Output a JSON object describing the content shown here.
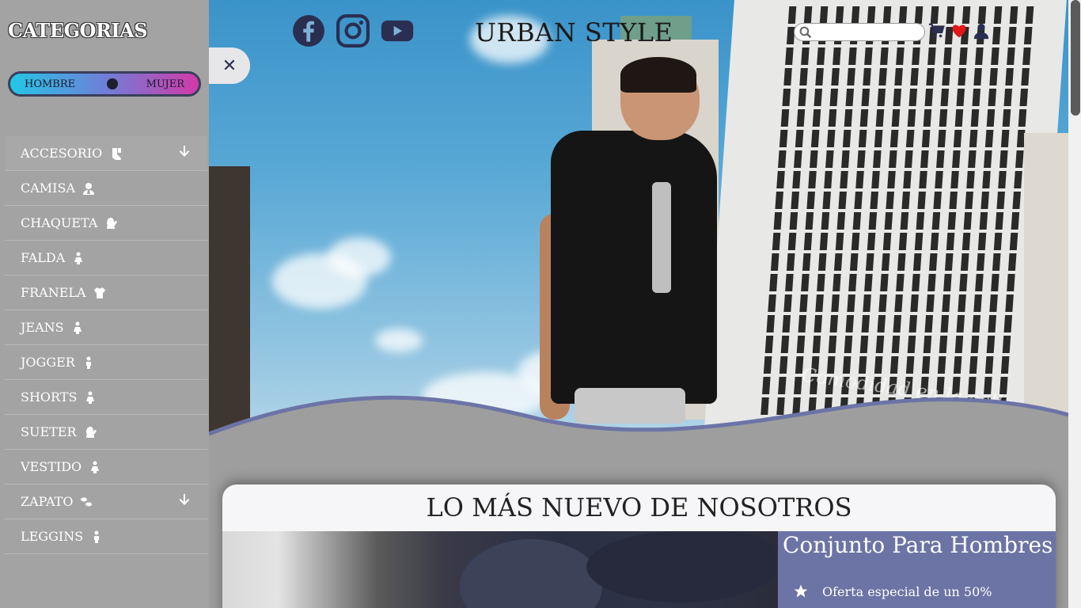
{
  "sidebar": {
    "title": "CATEGORIAS",
    "toggle": {
      "left_label": "HOMBRE",
      "right_label": "MUJER"
    },
    "items": [
      {
        "label": "ACCESORIO",
        "icon": "socks-icon",
        "has_submenu": true
      },
      {
        "label": "CAMISA",
        "icon": "user-tie-icon",
        "has_submenu": false
      },
      {
        "label": "CHAQUETA",
        "icon": "mitten-icon",
        "has_submenu": false
      },
      {
        "label": "FALDA",
        "icon": "female-icon",
        "has_submenu": false
      },
      {
        "label": "FRANELA",
        "icon": "tshirt-icon",
        "has_submenu": false
      },
      {
        "label": "JEANS",
        "icon": "female-icon",
        "has_submenu": false
      },
      {
        "label": "JOGGER",
        "icon": "male-icon",
        "has_submenu": false
      },
      {
        "label": "SHORTS",
        "icon": "female-icon",
        "has_submenu": false
      },
      {
        "label": "SUETER",
        "icon": "mitten-icon",
        "has_submenu": false
      },
      {
        "label": "VESTIDO",
        "icon": "female-icon",
        "has_submenu": false
      },
      {
        "label": "ZAPATO",
        "icon": "shoe-prints-icon",
        "has_submenu": true
      },
      {
        "label": "LEGGINS",
        "icon": "male-icon",
        "has_submenu": false
      }
    ]
  },
  "header": {
    "brand": "URBAN STYLE",
    "social": [
      "facebook-icon",
      "instagram-icon",
      "youtube-icon"
    ],
    "search": {
      "placeholder": "",
      "value": ""
    },
    "icons": [
      "cart-icon",
      "heart-icon",
      "user-icon"
    ]
  },
  "hero": {
    "watermark": "Comodidad en la calle"
  },
  "close_button": {
    "label": "✕"
  },
  "featured": {
    "title": "LO MÁS NUEVO DE NOSOTROS",
    "product_title": "Conjunto Para Hombres",
    "offer_text": "Oferta especial de un 50%"
  },
  "colors": {
    "sidebar_bg": "#a3a3a3",
    "toggle_left": "#23c7e6",
    "toggle_right": "#d23aa8",
    "social_icon": "#2a2f52",
    "heart": "#e01818",
    "wave_stroke": "#6c74a6",
    "panel_bg": "#6c74a6"
  }
}
